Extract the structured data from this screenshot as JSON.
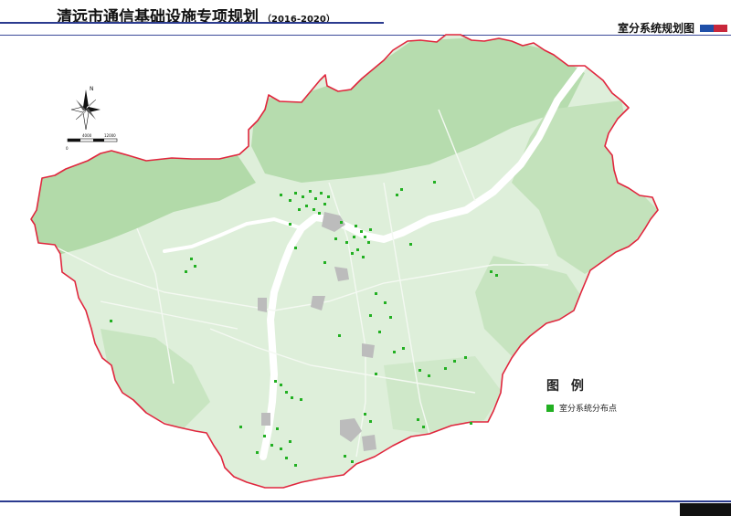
{
  "header": {
    "title": "清远市通信基础设施专项规划",
    "years": "（2016-2020）",
    "sheet_title": "室分系统规划图",
    "marker_colors": [
      "#1f4fa8",
      "#c8273b"
    ]
  },
  "compass": {
    "north_letter": "N",
    "scale_start": "0",
    "scale_mid": "4000",
    "scale_end": "12000"
  },
  "legend": {
    "title": "图 例",
    "items": [
      {
        "label": "室分系统分布点",
        "color": "#22b022"
      }
    ]
  },
  "colors": {
    "boundary": "#e0263d",
    "land_light": "#dbeed7",
    "land_green": "#b6dcaf",
    "river": "#ffffff",
    "urban": "#bdbdbd",
    "points": "#22b022"
  }
}
